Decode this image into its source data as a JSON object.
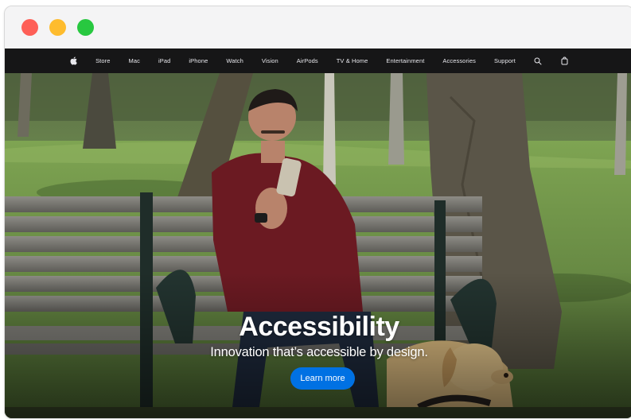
{
  "window": {
    "controls": [
      "close",
      "minimize",
      "maximize"
    ]
  },
  "nav": {
    "logo_icon": "apple-logo-icon",
    "items": [
      "Store",
      "Mac",
      "iPad",
      "iPhone",
      "Watch",
      "Vision",
      "AirPods",
      "TV & Home",
      "Entertainment",
      "Accessories",
      "Support"
    ],
    "search_icon": "search-icon",
    "bag_icon": "shopping-bag-icon"
  },
  "hero": {
    "title": "Accessibility",
    "subtitle": "Innovation that’s accessible by design.",
    "cta_label": "Learn more",
    "image_description_icon": "park-bench-photo"
  },
  "colors": {
    "nav_bg": "#161617",
    "cta_blue": "#0071e3",
    "close": "#fe5f57",
    "minimize": "#febc2e",
    "maximize": "#28c840"
  }
}
